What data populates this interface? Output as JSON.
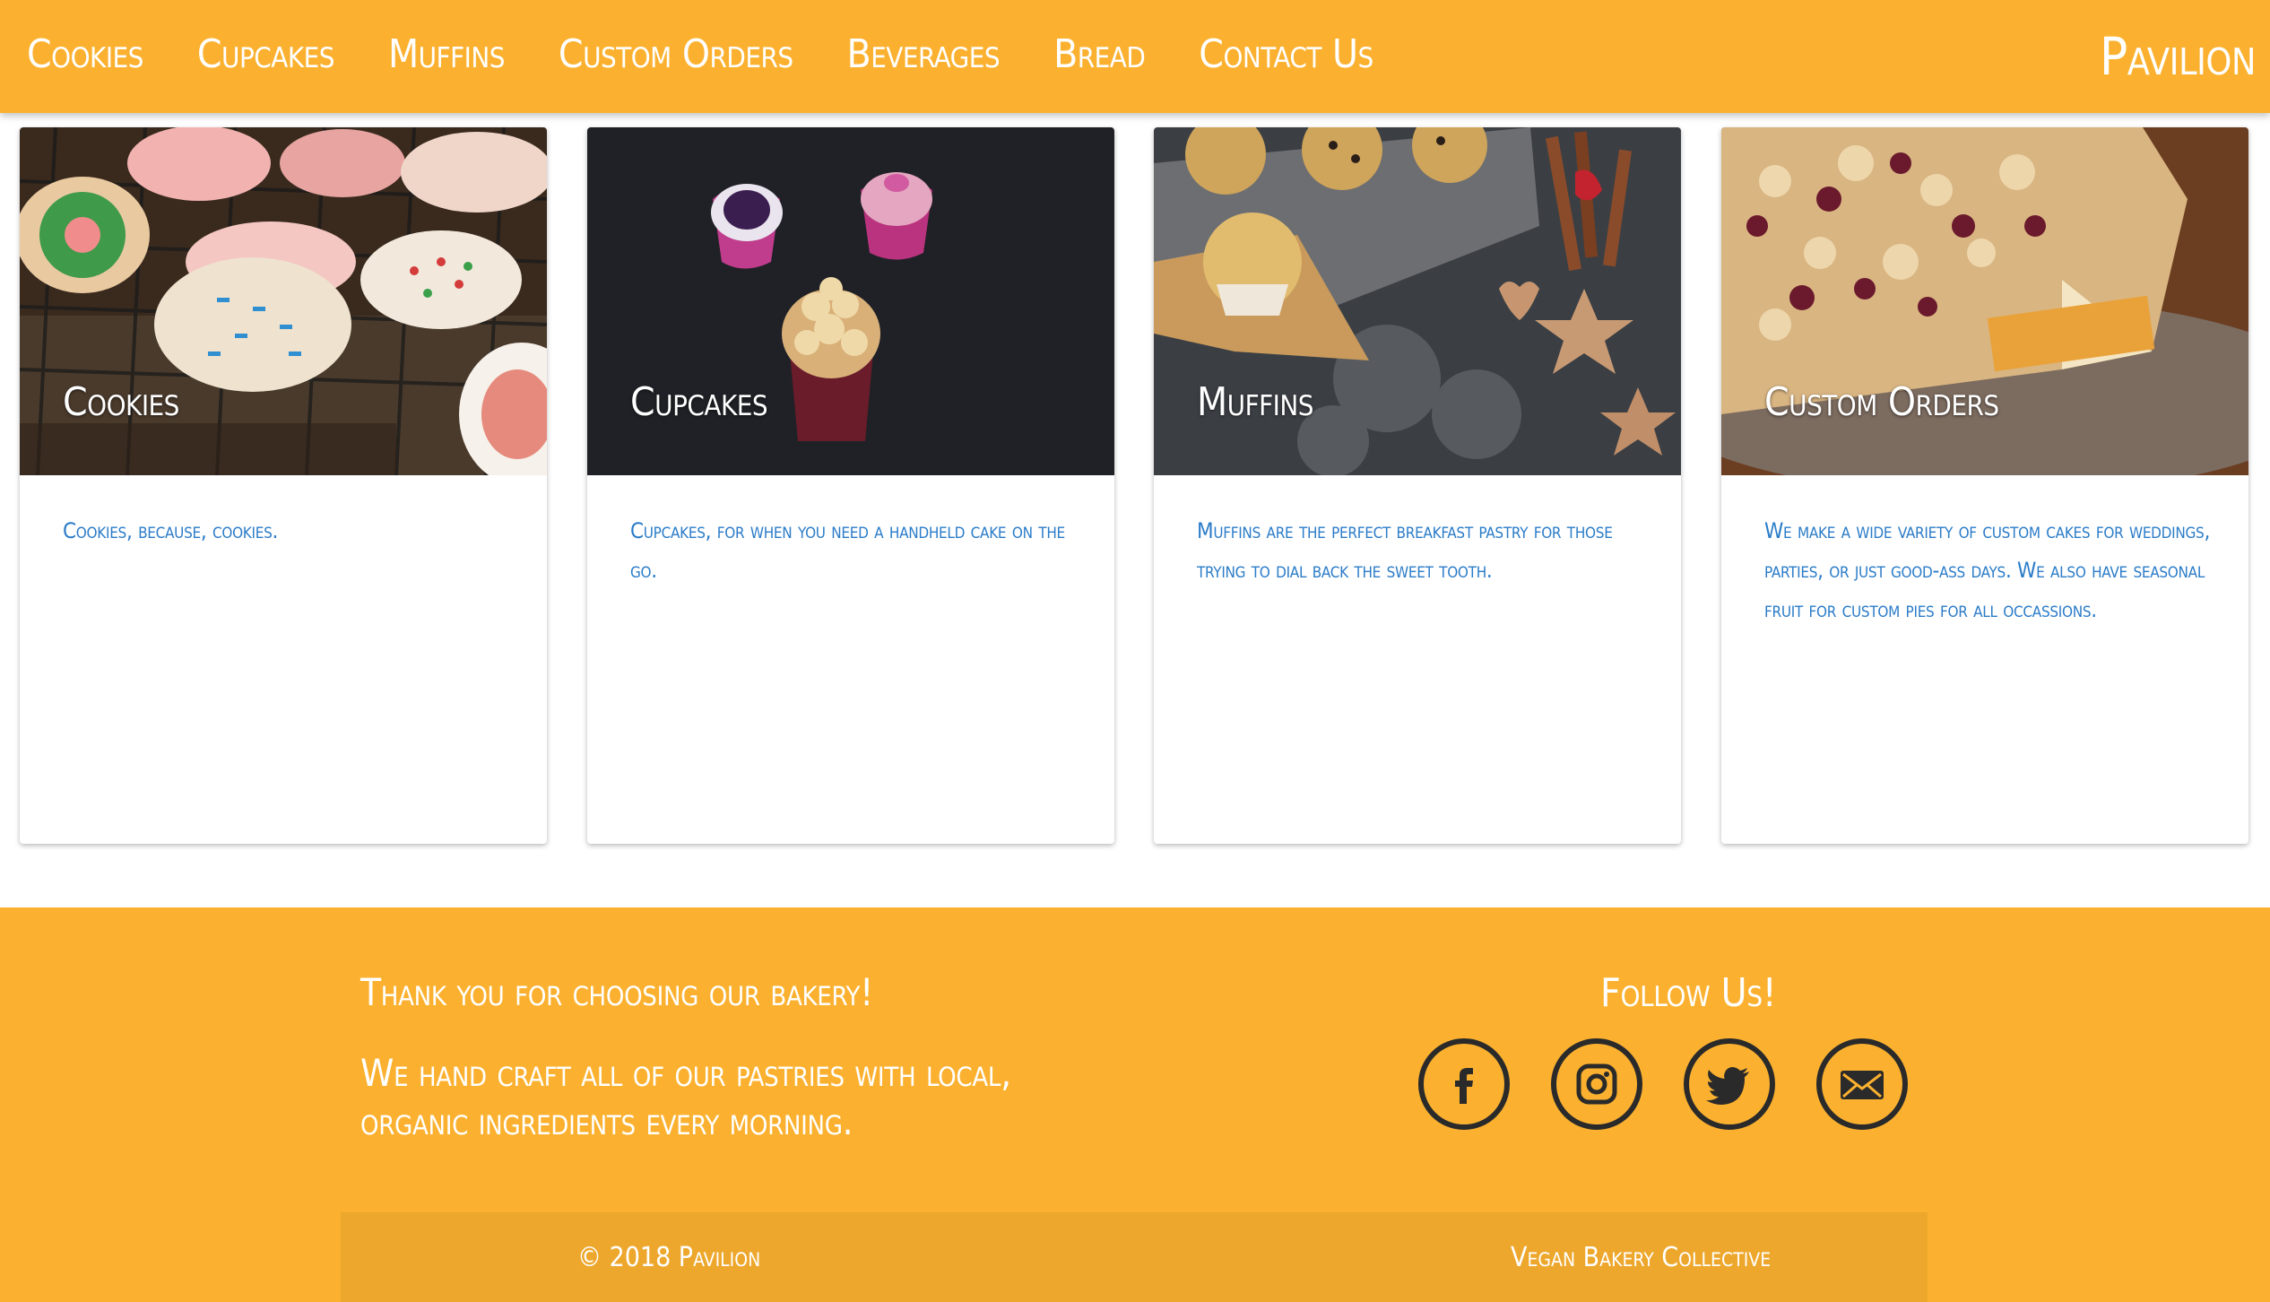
{
  "nav": {
    "items": [
      {
        "label": "Cookies"
      },
      {
        "label": "Cupcakes"
      },
      {
        "label": "Muffins"
      },
      {
        "label": "Custom Orders"
      },
      {
        "label": "Beverages"
      },
      {
        "label": "Bread"
      },
      {
        "label": "Contact Us"
      }
    ],
    "brand": "Pavilion"
  },
  "cards": [
    {
      "title": "Cookies",
      "description": "Cookies, because, cookies."
    },
    {
      "title": "Cupcakes",
      "description": "Cupcakes, for when you need a handheld cake on the go."
    },
    {
      "title": "Muffins",
      "description": "Muffins are the perfect breakfast pastry for those trying to dial back the sweet tooth."
    },
    {
      "title": "Custom Orders",
      "description": "We make a wide variety of custom cakes for weddings, parties, or just good-ass days. We also have seasonal fruit for custom pies for all occassions."
    }
  ],
  "footer": {
    "thanks": "Thank you for choosing our bakery!",
    "tagline": "We hand craft all of our pastries with local, organic ingredients every morning.",
    "follow": "Follow Us!",
    "social": [
      {
        "icon": "facebook-icon"
      },
      {
        "icon": "instagram-icon"
      },
      {
        "icon": "twitter-icon"
      },
      {
        "icon": "email-icon"
      }
    ],
    "copyright": "© 2018 Pavilion",
    "collective": "Vegan Bakery Collective"
  },
  "colors": {
    "accent": "#FBB12F",
    "footer_bar": "#EDA72C",
    "body_text": "#2B7CC8"
  }
}
